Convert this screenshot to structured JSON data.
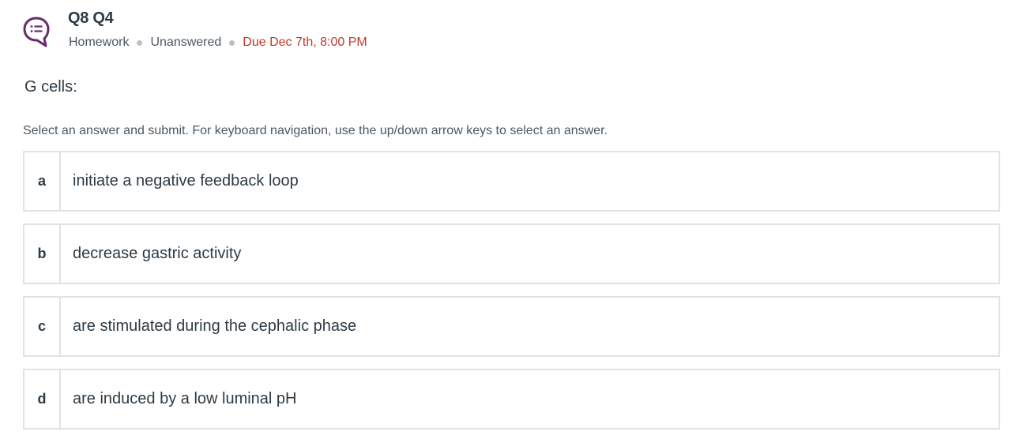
{
  "question": {
    "title": "Q8 Q4",
    "icon": "discussion-list-icon",
    "type": "Homework",
    "status": "Unanswered",
    "due": "Due Dec 7th, 8:00 PM",
    "prompt": "G cells:",
    "instructions": "Select an answer and submit. For keyboard navigation, use the up/down arrow keys to select an answer."
  },
  "answers": [
    {
      "letter": "a",
      "text": "initiate a negative feedback loop"
    },
    {
      "letter": "b",
      "text": "decrease gastric activity"
    },
    {
      "letter": "c",
      "text": "are stimulated during the cephalic phase"
    },
    {
      "letter": "d",
      "text": "are induced by a low luminal pH"
    }
  ],
  "colors": {
    "icon": "#6b2a6b",
    "due": "#c0392b",
    "border": "#dfe3e6",
    "text": "#2d3b45"
  }
}
